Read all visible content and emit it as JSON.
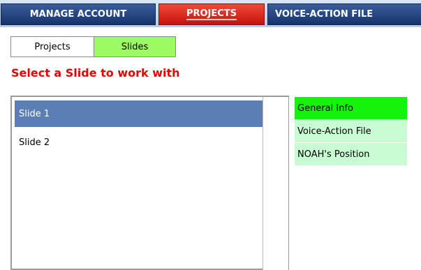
{
  "topnav": {
    "tabs": [
      {
        "label": "MANAGE ACCOUNT",
        "active": false
      },
      {
        "label": "PROJECTS",
        "active": true
      },
      {
        "label": "VOICE-ACTION FILE",
        "active": false
      }
    ]
  },
  "subtabs": [
    {
      "label": "Projects",
      "active": false
    },
    {
      "label": "Slides",
      "active": true
    }
  ],
  "heading": "Select a Slide to work with",
  "slides": {
    "items": [
      {
        "label": "Slide 1",
        "selected": true
      },
      {
        "label": "Slide 2",
        "selected": false
      }
    ]
  },
  "sidemenu": {
    "items": [
      {
        "label": "General Info",
        "active": true
      },
      {
        "label": "Voice-Action File",
        "active": false
      },
      {
        "label": "NOAH's Position",
        "active": false
      }
    ]
  },
  "colors": {
    "heading": "#e80000",
    "active_subtab": "#9cfb63",
    "active_sidemenu": "#15f20c",
    "sidemenu_bg": "#c8fcd3",
    "selected_item": "#5b7fb5",
    "nav_blue": "#16336b",
    "nav_red": "#c4120b"
  }
}
